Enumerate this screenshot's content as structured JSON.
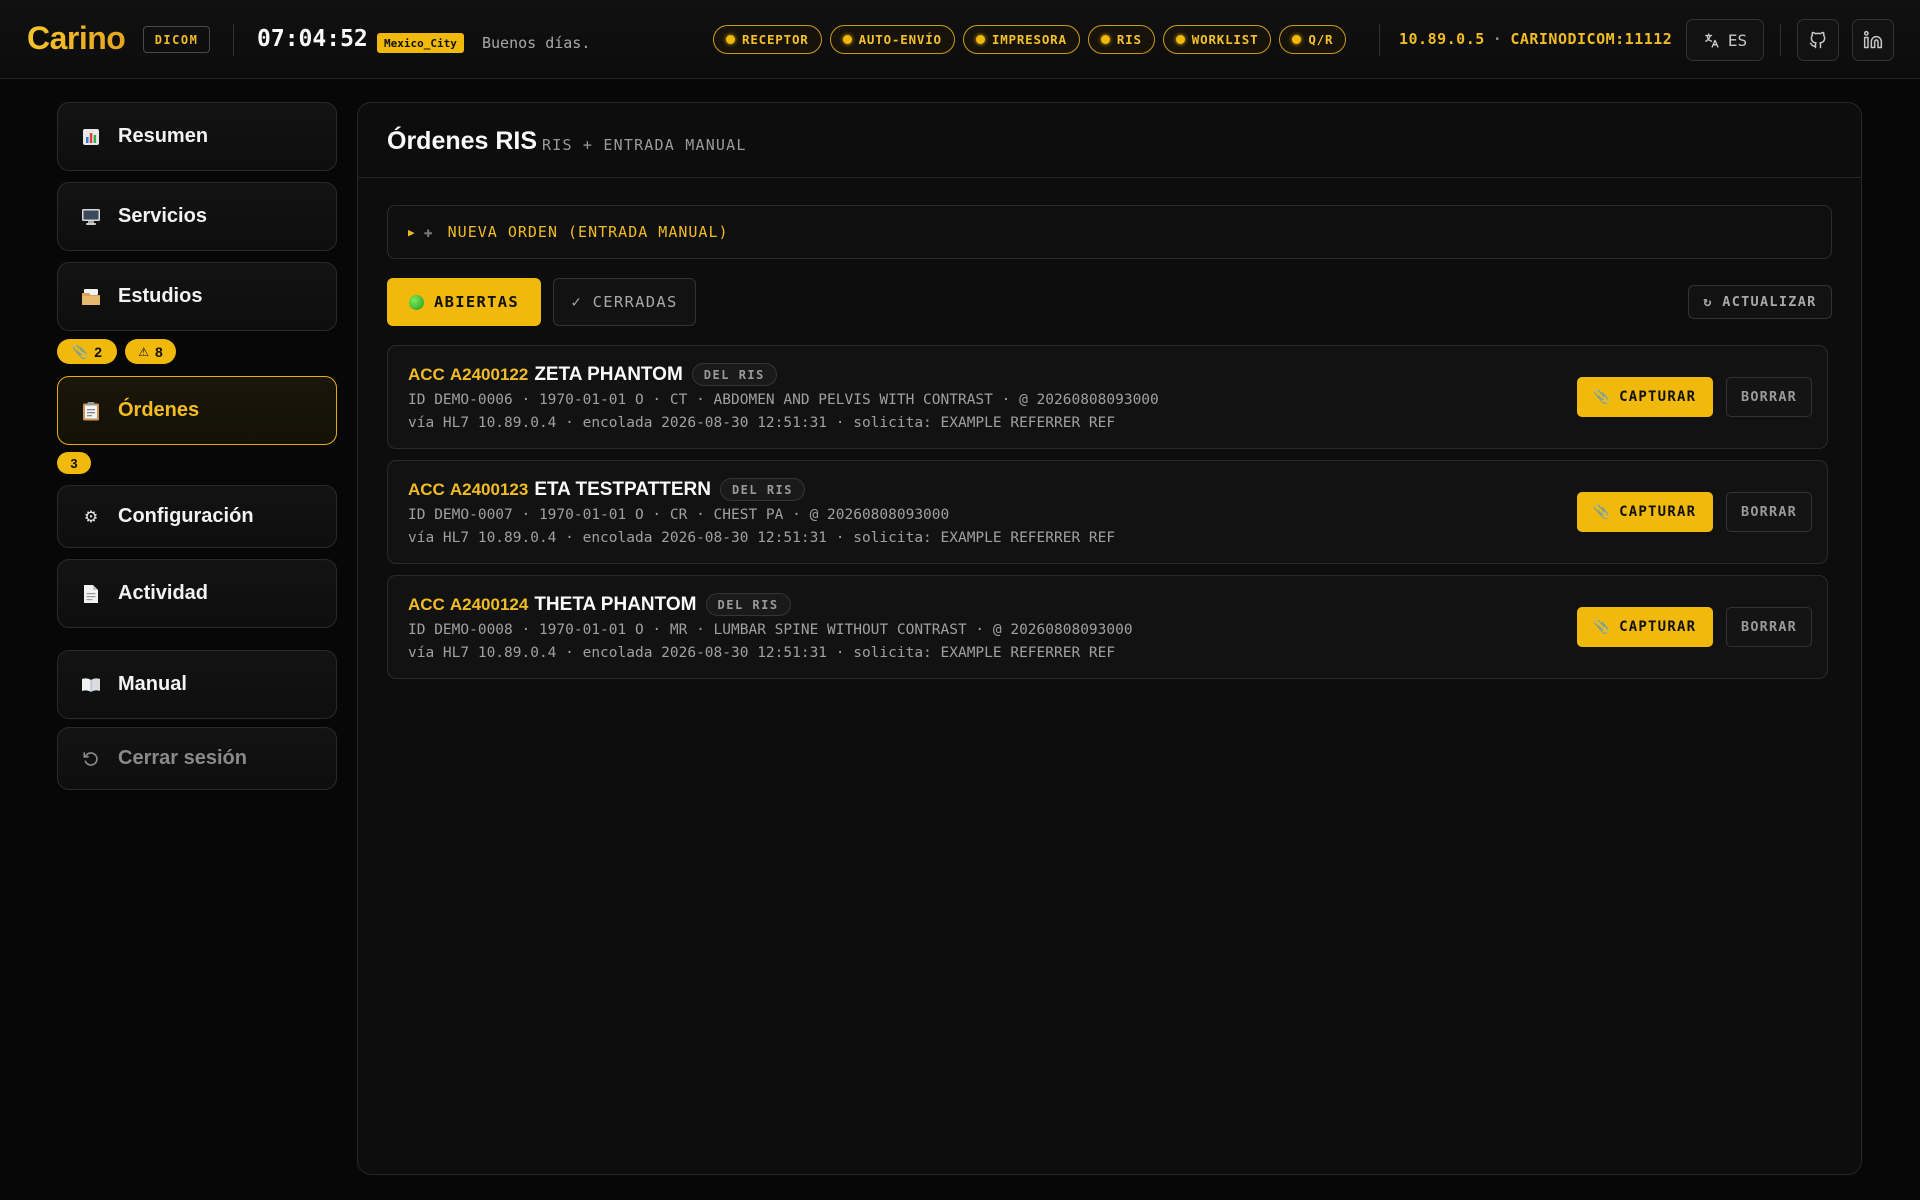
{
  "header": {
    "logo": "Carino",
    "tag": "DICOM",
    "clock": "07:04:52",
    "timezone": "Mexico_City",
    "greeting": "Buenos días.",
    "status_pills": [
      {
        "label": "RECEPTOR"
      },
      {
        "label": "AUTO-ENVÍO"
      },
      {
        "label": "IMPRESORA"
      },
      {
        "label": "RIS"
      },
      {
        "label": "WORKLIST"
      },
      {
        "label": "Q/R"
      }
    ],
    "ip": "10.89.0.5",
    "host_separator": "·",
    "ae_port": "CARINODICOM:11112",
    "language": "ES",
    "accent_color": "#f0b90b"
  },
  "sidebar": {
    "items": [
      {
        "label": "Resumen",
        "icon": "bar-chart-icon"
      },
      {
        "label": "Servicios",
        "icon": "monitor-icon"
      },
      {
        "label": "Estudios",
        "icon": "folder-icon"
      },
      {
        "label": "Órdenes",
        "icon": "clipboard-icon"
      },
      {
        "label": "Configuración",
        "icon": "gear-icon"
      },
      {
        "label": "Actividad",
        "icon": "document-icon"
      },
      {
        "label": "Manual",
        "icon": "book-icon"
      },
      {
        "label": "Cerrar sesión",
        "icon": "logout-icon"
      }
    ],
    "studies_badges": {
      "captures": "2",
      "warnings": "8"
    },
    "orders_badge": "3"
  },
  "main": {
    "title": "Órdenes RIS",
    "subtitle": "RIS + ENTRADA MANUAL",
    "new_order": {
      "arrow": "▶",
      "plus": "✚",
      "label": "NUEVA ORDEN (ENTRADA MANUAL)"
    },
    "tabs": {
      "open": "ABIERTAS",
      "closed": "✓ CERRADAS"
    },
    "refresh": "↻ ACTUALIZAR",
    "orders": [
      {
        "acc_label": "ACC",
        "acc": "A2400122",
        "patient": "ZETA PHANTOM",
        "source": "DEL RIS",
        "details": "ID DEMO-0006 · 1970-01-01 O · CT · ABDOMEN AND PELVIS WITH CONTRAST · @ 20260808093000",
        "meta": "vía HL7 10.89.0.4 · encolada 2026-08-30 12:51:31 · solicita: EXAMPLE REFERRER REF",
        "capture": "CAPTURAR",
        "delete": "BORRAR"
      },
      {
        "acc_label": "ACC",
        "acc": "A2400123",
        "patient": "ETA TESTPATTERN",
        "source": "DEL RIS",
        "details": "ID DEMO-0007 · 1970-01-01 O · CR · CHEST PA · @ 20260808093000",
        "meta": "vía HL7 10.89.0.4 · encolada 2026-08-30 12:51:31 · solicita: EXAMPLE REFERRER REF",
        "capture": "CAPTURAR",
        "delete": "BORRAR"
      },
      {
        "acc_label": "ACC",
        "acc": "A2400124",
        "patient": "THETA PHANTOM",
        "source": "DEL RIS",
        "details": "ID DEMO-0008 · 1970-01-01 O · MR · LUMBAR SPINE WITHOUT CONTRAST · @ 20260808093000",
        "meta": "vía HL7 10.89.0.4 · encolada 2026-08-30 12:51:31 · solicita: EXAMPLE REFERRER REF",
        "capture": "CAPTURAR",
        "delete": "BORRAR"
      }
    ]
  }
}
